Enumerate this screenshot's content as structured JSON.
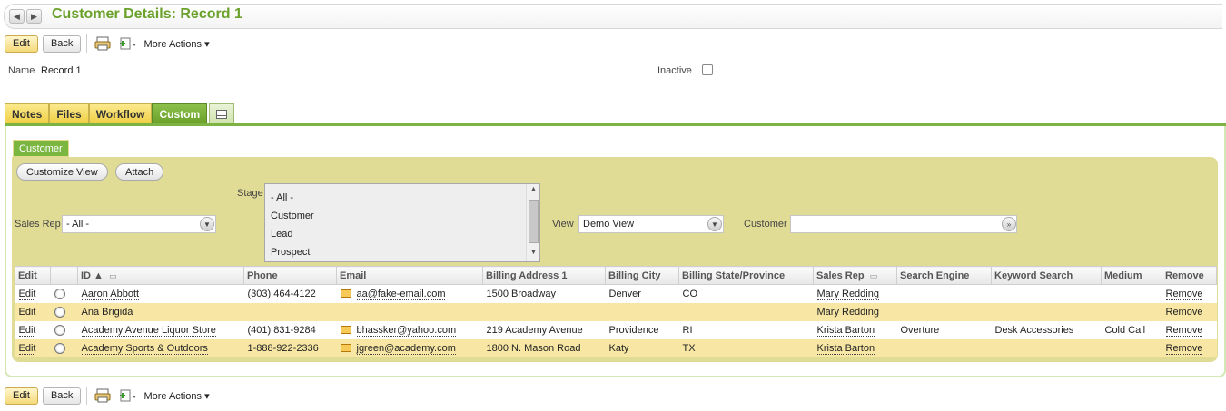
{
  "header": {
    "title": "Customer Details: Record 1",
    "back_icon": "arrow-left-icon",
    "forward_icon": "arrow-right-icon"
  },
  "toolbar": {
    "edit_label": "Edit",
    "back_label": "Back",
    "more_actions_label": "More Actions ▾",
    "print_icon": "print-icon",
    "new_icon": "new-record-icon"
  },
  "record": {
    "name_label": "Name",
    "name_value": "Record 1",
    "inactive_label": "Inactive",
    "inactive_checked": false
  },
  "tabs": [
    {
      "label": "Notes"
    },
    {
      "label": "Files"
    },
    {
      "label": "Workflow"
    },
    {
      "label": "Custom",
      "active": true
    }
  ],
  "subtab": {
    "label": "Customer"
  },
  "sublist": {
    "customize_view_label": "Customize View",
    "attach_label": "Attach",
    "sales_rep_label": "Sales Rep",
    "sales_rep_value": "- All -",
    "stage_label": "Stage",
    "stage_options": [
      "- All -",
      "Customer",
      "Lead",
      "Prospect"
    ],
    "view_label": "View",
    "view_value": "Demo View",
    "customer_label": "Customer",
    "customer_value": ""
  },
  "table": {
    "columns": [
      "Edit",
      "",
      "ID ▲",
      "Phone",
      "Email",
      "Billing Address 1",
      "Billing City",
      "Billing State/Province",
      "Sales Rep",
      "Search Engine",
      "Keyword Search",
      "Medium",
      "Remove"
    ],
    "rows": [
      {
        "edit": "Edit",
        "id": "Aaron Abbott",
        "phone": "(303) 464-4122",
        "email": "aa@fake-email.com",
        "address": "1500 Broadway",
        "city": "Denver",
        "state": "CO",
        "sales_rep": "Mary Redding",
        "search_engine": "",
        "keyword": "",
        "medium": "",
        "remove": "Remove"
      },
      {
        "edit": "Edit",
        "id": "Ana Brigida",
        "phone": "",
        "email": "",
        "address": "",
        "city": "",
        "state": "",
        "sales_rep": "Mary Redding",
        "search_engine": "",
        "keyword": "",
        "medium": "",
        "remove": "Remove"
      },
      {
        "edit": "Edit",
        "id": "Academy Avenue Liquor Store",
        "phone": "(401) 831-9284",
        "email": "bhassker@yahoo.com",
        "address": "219 Academy Avenue",
        "city": "Providence",
        "state": "RI",
        "sales_rep": "Krista Barton",
        "search_engine": "Overture",
        "keyword": "Desk Accessories",
        "medium": "Cold Call",
        "remove": "Remove"
      },
      {
        "edit": "Edit",
        "id": "Academy Sports & Outdoors",
        "phone": "1-888-922-2336",
        "email": "jgreen@academy.com",
        "address": "1800 N. Mason Road",
        "city": "Katy",
        "state": "TX",
        "sales_rep": "Krista Barton",
        "search_engine": "",
        "keyword": "",
        "medium": "",
        "remove": "Remove"
      }
    ]
  },
  "colors": {
    "title_green": "#6aa12a",
    "tab_yellow": "#f0cf45",
    "panel_khaki": "#e1dc95",
    "row_alt": "#f8e7a4"
  }
}
